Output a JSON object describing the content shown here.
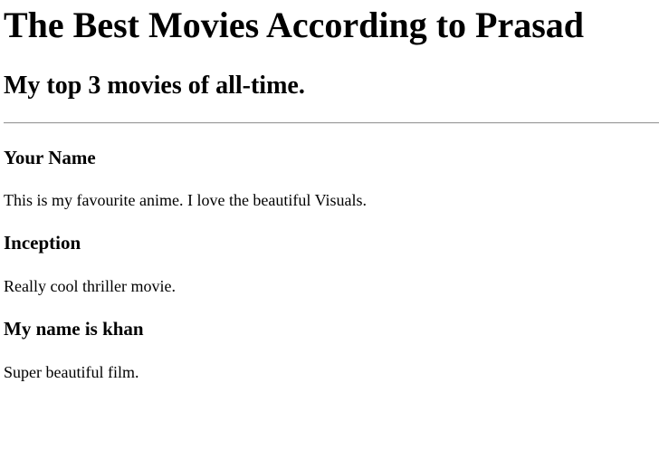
{
  "page": {
    "title": "The Best Movies According to Prasad",
    "subtitle": "My top 3 movies of all-time."
  },
  "movies": [
    {
      "name": "Your Name",
      "description": "This is my favourite anime. I love the beautiful Visuals."
    },
    {
      "name": "Inception",
      "description": "Really cool thriller movie."
    },
    {
      "name": "My name is khan",
      "description": "Super beautiful film."
    }
  ]
}
